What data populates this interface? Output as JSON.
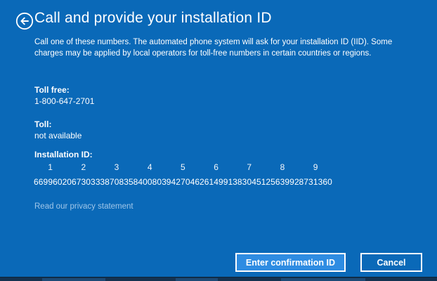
{
  "header": {
    "title": "Call and provide your installation ID",
    "back_icon": "back-arrow-icon"
  },
  "description_lines": [
    "Call one of these numbers. The automated phone system will ask for your installation ID (IID). Some",
    "charges may be applied by local operators for toll-free numbers in certain countries or regions."
  ],
  "toll_free": {
    "label": "Toll free:",
    "value": "1-800-647-2701"
  },
  "toll": {
    "label": "Toll:",
    "value": "not available"
  },
  "installation_id": {
    "label": "Installation ID:",
    "groups": [
      {
        "index": "1",
        "digits": "6699602"
      },
      {
        "index": "2",
        "digits": "0673033"
      },
      {
        "index": "3",
        "digits": "3870835"
      },
      {
        "index": "4",
        "digits": "8400803"
      },
      {
        "index": "5",
        "digits": "9427046"
      },
      {
        "index": "6",
        "digits": "2614991"
      },
      {
        "index": "7",
        "digits": "3830451"
      },
      {
        "index": "8",
        "digits": "2563992"
      },
      {
        "index": "9",
        "digits": "8731360"
      }
    ]
  },
  "privacy_link": "Read our privacy statement",
  "buttons": {
    "confirm": "Enter confirmation ID",
    "cancel": "Cancel"
  },
  "colors": {
    "background": "#0a69b8",
    "confirm_button_bg": "#2e8ce2",
    "button_border": "#ffffff",
    "link_color": "#9fc6e9",
    "bottom_strip": "#143250"
  }
}
